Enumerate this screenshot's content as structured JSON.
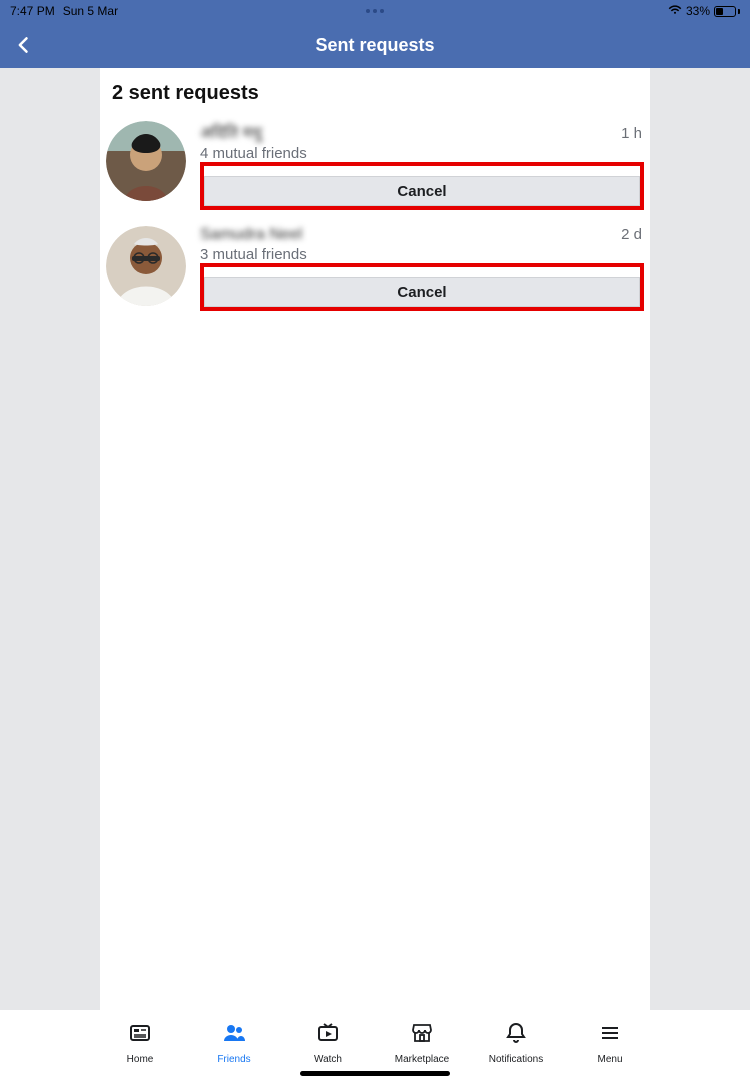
{
  "status": {
    "time": "7:47 PM",
    "date": "Sun 5 Mar",
    "battery_pct": "33%"
  },
  "header": {
    "title": "Sent requests"
  },
  "page": {
    "title": "2 sent requests"
  },
  "requests": [
    {
      "name": "अदिति मधु",
      "mutual": "4 mutual friends",
      "time": "1 h",
      "cancel_label": "Cancel"
    },
    {
      "name": "Samudra Neel",
      "mutual": "3 mutual friends",
      "time": "2 d",
      "cancel_label": "Cancel"
    }
  ],
  "tabs": {
    "home": "Home",
    "friends": "Friends",
    "watch": "Watch",
    "marketplace": "Marketplace",
    "notifications": "Notifications",
    "menu": "Menu"
  }
}
